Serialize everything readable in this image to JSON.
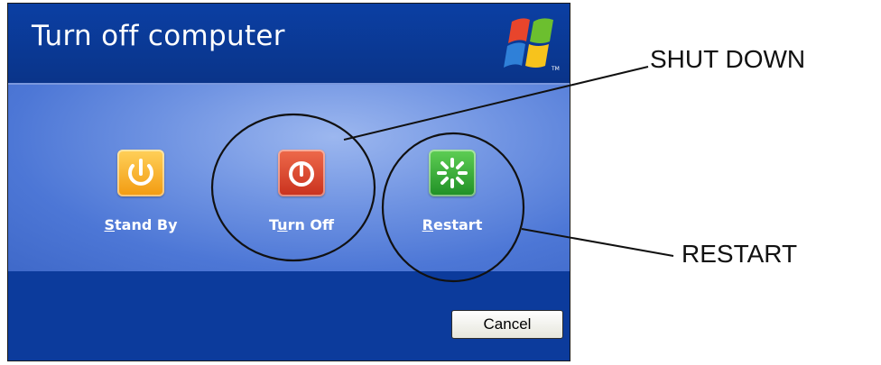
{
  "dialog": {
    "title": "Turn off computer",
    "options": [
      {
        "label": "Stand By",
        "accel": "S"
      },
      {
        "label": "Turn Off",
        "accel": "u"
      },
      {
        "label": "Restart",
        "accel": "R"
      }
    ],
    "cancel_label": "Cancel",
    "colors": {
      "title_bar": "#0b3fa3",
      "body_panel": "#6f93e2",
      "bottom_bar": "#0c3b9c",
      "stand_by_tile": "#f29a10",
      "turn_off_tile": "#c9311d",
      "restart_tile": "#1f8f25"
    },
    "logo_icon": "windows-xp-logo"
  },
  "annotations": {
    "shutdown_label": "SHUT DOWN",
    "restart_label": "RESTART"
  }
}
